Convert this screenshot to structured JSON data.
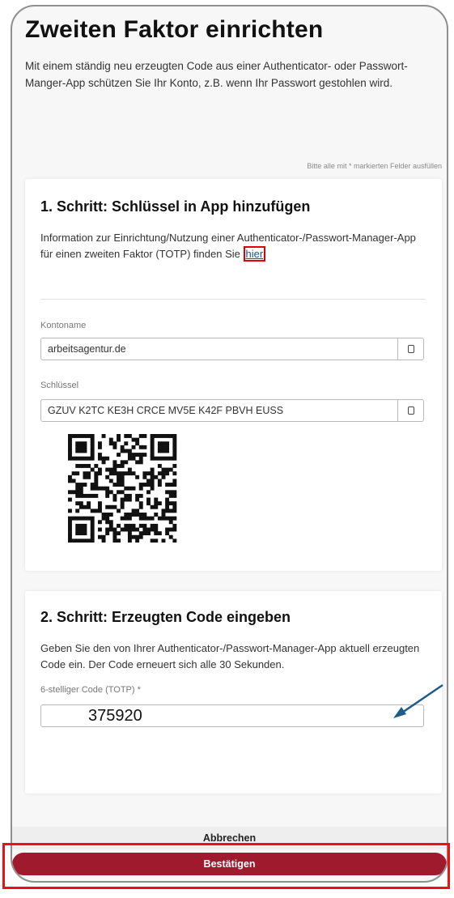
{
  "page": {
    "title": "Zweiten Faktor einrichten",
    "intro": "Mit einem ständig neu erzeugten Code aus einer Authenticator- oder Passwort-Manger-App schützen Sie Ihr Konto, z.B. wenn Ihr Passwort gestohlen wird.",
    "required_hint": "Bitte alle mit * markierten Felder ausfüllen"
  },
  "step1": {
    "title": "1. Schritt: Schlüssel in App hinzufügen",
    "info_text": "Information zur Einrichtung/Nutzung einer Authenticator-/Passwort-Manager-App für einen zweiten Faktor (TOTP) finden Sie",
    "link_label": "hier",
    "account_label": "Kontoname",
    "account_value": "arbeitsagentur.de",
    "key_label": "Schlüssel",
    "key_value": "GZUV K2TC KE3H CRCE MV5E K42F PBVH EUSS"
  },
  "step2": {
    "title": "2. Schritt: Erzeugten Code eingeben",
    "info_text": "Geben Sie den von Ihrer Authenticator-/Passwort-Manager-App aktuell erzeugten Code ein. Der Code erneuert sich alle 30 Sekunden.",
    "code_label": "6-stelliger Code (TOTP) *",
    "code_value": "375920"
  },
  "actions": {
    "cancel_label": "Abbrechen",
    "confirm_label": "Bestätigen"
  },
  "icons": {
    "copy": "copy-icon",
    "qr": "qr-code"
  },
  "colors": {
    "confirm": "#9e1a2c",
    "highlight": "#ee1111",
    "arrow": "#1d5c8a"
  }
}
